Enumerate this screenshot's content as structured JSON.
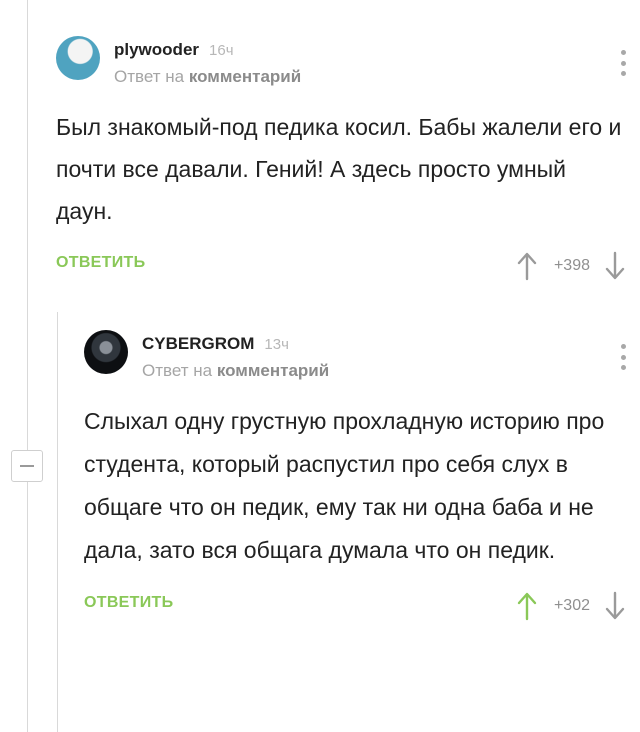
{
  "comments": [
    {
      "username": "plywooder",
      "time": "16ч",
      "reply_prefix": "Ответ на",
      "reply_target": "комментарий",
      "text": "Был знакомый-под педика косил. Бабы жалели его и почти все давали. Гений! А здесь просто умный даун.",
      "reply_label": "ОТВЕТИТЬ",
      "score": "+398",
      "upvote_color": "#9a9a9a"
    },
    {
      "username": "CYBERGROM",
      "time": "13ч",
      "reply_prefix": "Ответ на",
      "reply_target": "комментарий",
      "text": "Слыхал одну грустную прохладную историю про студента, который распустил про себя слух в общаге что он педик, ему так ни одна баба и не дала, зато вся общага думала что он педик.",
      "reply_label": "ОТВЕТИТЬ",
      "score": "+302",
      "upvote_color": "#8ac858"
    }
  ],
  "icons": {
    "menu": "vertical-dots-icon",
    "upvote": "arrow-up-icon",
    "downvote": "arrow-down-icon",
    "collapse": "minus-icon"
  },
  "colors": {
    "accent": "#8ac858",
    "muted": "#a5a5a5"
  }
}
